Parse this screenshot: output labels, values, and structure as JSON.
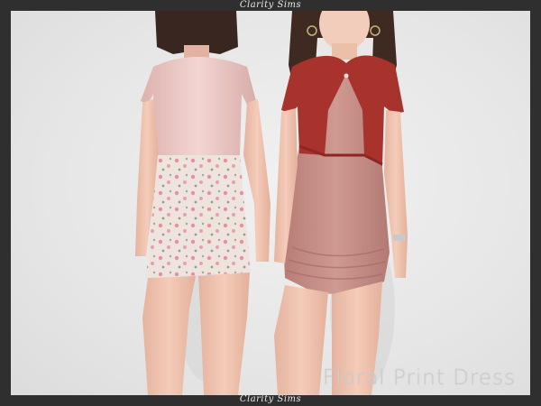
{
  "watermark": {
    "top": "Clarity Sims",
    "bottom": "Clarity Sims"
  },
  "product": {
    "title": "Floral Print Dress"
  },
  "colors": {
    "frame": "#2f2f2f",
    "background": "#e8e8e8",
    "cardigan": "#a8332c",
    "dress": "#c79088",
    "tshirt": "#e8c4c1",
    "skirt_base": "#efe3dd",
    "skirt_flowers": "#e88fa2",
    "skin": "#f2c6b2",
    "hair": "#3a2620"
  }
}
